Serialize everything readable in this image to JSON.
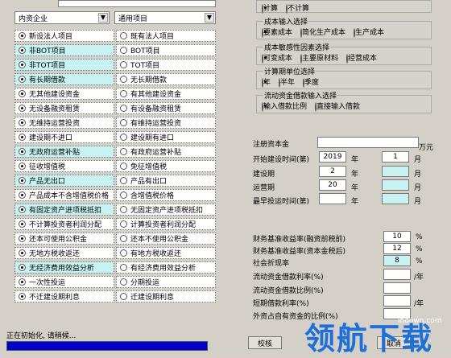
{
  "dropdowns": {
    "left": "内资企业",
    "right": "通用项目"
  },
  "left_rows": [
    {
      "opt1": "新设法人项目",
      "opt2": "既有法人项目",
      "selected": 1
    },
    {
      "opt1": "非BOT项目",
      "opt2": "BOT项目",
      "selected": 1
    },
    {
      "opt1": "非TOT项目",
      "opt2": "TOT项目",
      "selected": 1
    },
    {
      "opt1": "有长期借款",
      "opt2": "无长期借款",
      "selected": 1
    },
    {
      "opt1": "无其他建设资金",
      "opt2": "有其他建设资金",
      "selected": 1
    },
    {
      "opt1": "无设备融资租赁",
      "opt2": "有设备融资租赁",
      "selected": 1
    },
    {
      "opt1": "无维持运营投资",
      "opt2": "有维持运营投资",
      "selected": 1
    },
    {
      "opt1": "建设期不进口",
      "opt2": "建设期有进口",
      "selected": 1
    },
    {
      "opt1": "无政府运营补贴",
      "opt2": "有政府运营补贴",
      "selected": 1
    },
    {
      "opt1": "征收增值税",
      "opt2": "免征增值税",
      "selected": 1
    },
    {
      "opt1": "产品无出口",
      "opt2": "产品有出口",
      "selected": 1
    },
    {
      "opt1": "产品成本不含增值税价格",
      "opt2": "含增值税价格",
      "selected": 1
    },
    {
      "opt1": "有固定资产进项税抵扣",
      "opt2": "无固定资产进项税抵扣",
      "selected": 1
    },
    {
      "opt1": "不计算投资者利润分配",
      "opt2": "计算投资者利润分配",
      "selected": 1
    },
    {
      "opt1": "还本可使用公积金",
      "opt2": "还本不使用公积金",
      "selected": 1
    },
    {
      "opt1": "无地方税收返还",
      "opt2": "有地方税收返还",
      "selected": 1
    },
    {
      "opt1": "无经济费用效益分析",
      "opt2": "有经济费用效益分析",
      "selected": 1
    },
    {
      "opt1": "一次性投运",
      "opt2": "分期投运",
      "selected": 1
    },
    {
      "opt1": "不迁建设期利息",
      "opt2": "迁建设期利息",
      "selected": 1
    }
  ],
  "right_groups": [
    {
      "title": "",
      "options": [
        "计算",
        "不计算"
      ],
      "selected": 1
    },
    {
      "title": "成本输入选择",
      "options": [
        "要素成本",
        "简化生产成本",
        "生产成本"
      ],
      "selected": 1
    },
    {
      "title": "成本敏感性因素选择",
      "options": [
        "可变成本",
        "主要原材料",
        "经营成本"
      ],
      "selected": 1
    },
    {
      "title": "计算期单位选择",
      "options": [
        "年",
        "半年",
        "季度"
      ],
      "selected": 1
    },
    {
      "title": "流动资金借款输入选择",
      "options": [
        "输入借款比例",
        "直接输入借款"
      ],
      "selected": 1
    }
  ],
  "form": {
    "registered_capital": "注册资本金",
    "registered_capital_unit": "万元",
    "start_build_time": "开始建设时间(第)",
    "year_label": "年",
    "start_year": "2019",
    "start_month": "1",
    "month_label": "月",
    "build_period": "建设期",
    "build_value": "2",
    "operation_period": "运营期",
    "operation_value": "20",
    "latest_invest_time": "最早投运时间(第)",
    "fin_rate_before": "财务基准收益率(融资前税前)",
    "fin_rate_before_value": "10",
    "fin_rate_capital": "财务基准收益率(资本金税后)",
    "fin_rate_capital_value": "12",
    "social_rate": "社会折现率",
    "social_rate_value": "8",
    "working_capital_loan_rate": "流动资金借款利率(%)",
    "working_capital_loan_ratio": "流动资金借款比例(%)",
    "short_term_loan_rate": "短期借款利率(%)",
    "external_cash": "外资占自有资金的比例(%)",
    "percent": "%",
    "per_year": "/年"
  },
  "buttons": {
    "check": "校核",
    "cancel": "取消"
  },
  "status": {
    "text": "正在初始化, 请稍候..."
  },
  "watermark": "领航下载",
  "watermark_small": "lhdown.com"
}
